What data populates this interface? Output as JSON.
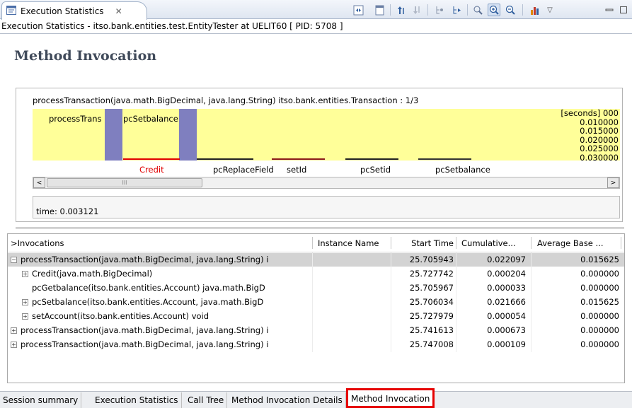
{
  "view_tab": {
    "label": "Execution Statistics",
    "close": "✕"
  },
  "subtitle": "Execution Statistics - itso.bank.entities.test.EntityTester at UELIT60 [ PID: 5708 ]",
  "page_title": "Method Invocation",
  "graph": {
    "title": "processTransaction(java.math.BigDecimal, java.lang.String) itso.bank.entities.Transaction : 1/3",
    "block_labels": [
      "processTrans",
      "pcSetbalance"
    ],
    "call_labels": [
      "Credit",
      "pcReplaceField",
      "setId",
      "pcSetid",
      "pcSetbalance"
    ],
    "axis_labels": [
      "[seconds] 000",
      "0.010000",
      "0.015000",
      "0.020000",
      "0.025000",
      "0.030000"
    ],
    "time_label": "time: 0.003121",
    "scroll_left": "<",
    "scroll_right": ">",
    "scroll_thumb": "III",
    "colors": {
      "background": "#ffff99",
      "bar": "#7f7fbf",
      "credit_text": "#e00000"
    }
  },
  "table": {
    "columns": [
      "Invocations",
      "Instance Name",
      "Start Time",
      "Cumulative...",
      "Average Base ..."
    ],
    "sort_marker": ">",
    "rows": [
      {
        "name": "processTransaction(java.math.BigDecimal, java.lang.String) i",
        "instance": "",
        "start": "25.705943",
        "cumulative": "0.022097",
        "average": "0.015625",
        "expander": "−",
        "selected": true
      },
      {
        "name": "Credit(java.math.BigDecimal)",
        "instance": "",
        "start": "25.727742",
        "cumulative": "0.000204",
        "average": "0.000000",
        "expander": "+"
      },
      {
        "name": "pcGetbalance(itso.bank.entities.Account) java.math.BigD",
        "instance": "",
        "start": "25.705967",
        "cumulative": "0.000033",
        "average": "0.000000",
        "expander": ""
      },
      {
        "name": "pcSetbalance(itso.bank.entities.Account, java.math.BigD",
        "instance": "",
        "start": "25.706034",
        "cumulative": "0.021666",
        "average": "0.015625",
        "expander": "+"
      },
      {
        "name": "setAccount(itso.bank.entities.Account) void",
        "instance": "",
        "start": "25.727979",
        "cumulative": "0.000054",
        "average": "0.000000",
        "expander": "+"
      },
      {
        "name": "processTransaction(java.math.BigDecimal, java.lang.String) i",
        "instance": "",
        "start": "25.741613",
        "cumulative": "0.000673",
        "average": "0.000000",
        "expander": "+"
      },
      {
        "name": "processTransaction(java.math.BigDecimal, java.lang.String) i",
        "instance": "",
        "start": "25.747008",
        "cumulative": "0.000109",
        "average": "0.000000",
        "expander": "+"
      }
    ]
  },
  "bottom_tabs": [
    "Session summary",
    "Execution Statistics",
    "Call Tree",
    "Method Invocation Details",
    "Method Invocation"
  ],
  "active_bottom_tab": "Method Invocation",
  "toolbar_icons": [
    "open-source-icon",
    "export-icon",
    "sort-up-icon",
    "sort-down-icon",
    "step-in-icon",
    "step-out-icon",
    "zoom-fit-icon",
    "zoom-in-icon",
    "zoom-out-icon",
    "chart-icon",
    "view-menu-icon",
    "minimize-icon",
    "maximize-icon"
  ]
}
